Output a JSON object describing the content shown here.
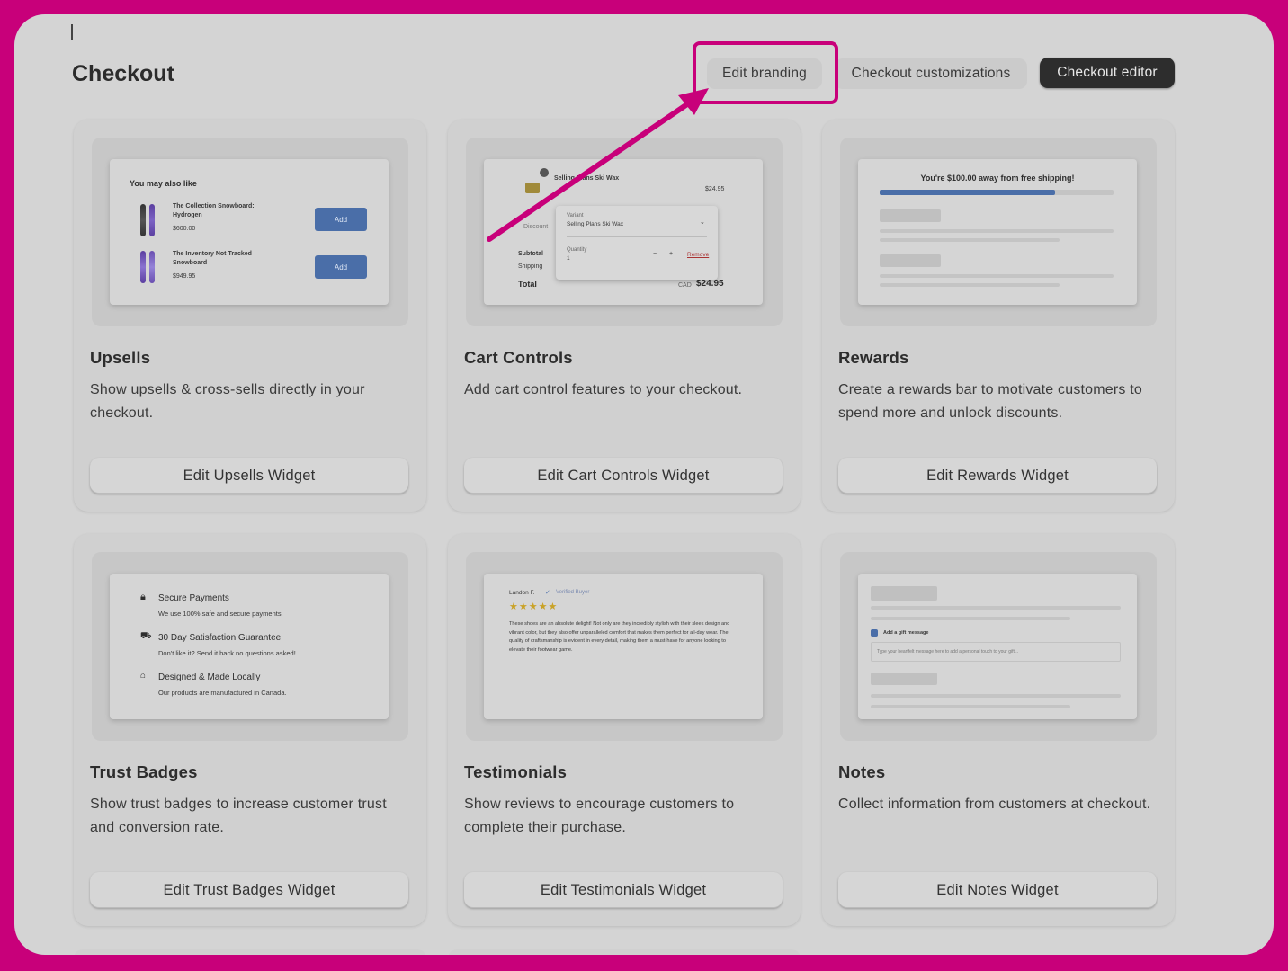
{
  "header": {
    "title": "Checkout",
    "buttons": {
      "branding": "Edit branding",
      "customizations": "Checkout customizations",
      "editor": "Checkout editor"
    }
  },
  "colors": {
    "annotation": "#c8007a",
    "primary_button": "#2d2d2d",
    "add_button": "#4a6ea8"
  },
  "cards": [
    {
      "title": "Upsells",
      "desc": "Show upsells & cross-sells directly in your checkout.",
      "button": "Edit Upsells Widget",
      "preview": {
        "heading": "You may also like",
        "items": [
          {
            "name": "The Collection Snowboard: Hydrogen",
            "price": "$600.00",
            "button": "Add"
          },
          {
            "name": "The Inventory Not Tracked Snowboard",
            "price": "$949.95",
            "button": "Add"
          }
        ]
      }
    },
    {
      "title": "Cart Controls",
      "desc": "Add cart control features to your checkout.",
      "button": "Edit Cart Controls Widget",
      "preview": {
        "product": "Selling Plans Ski Wax",
        "price": "$24.95",
        "variant_label": "Variant",
        "variant_value": "Selling Plans Ski Wax",
        "quantity_label": "Quantity",
        "quantity_value": "1",
        "remove": "Remove",
        "discount": "Discount",
        "subtotal": "Subtotal",
        "shipping": "Shipping",
        "total": "Total",
        "currency": "CAD",
        "total_value": "$24.95"
      }
    },
    {
      "title": "Rewards",
      "desc": "Create a rewards bar to motivate customers to spend more and unlock discounts.",
      "button": "Edit Rewards Widget",
      "preview": {
        "message": "You're $100.00 away from free shipping!",
        "progress": 0.75
      }
    },
    {
      "title": "Trust Badges",
      "desc": "Show trust badges to increase customer trust and conversion rate.",
      "button": "Edit Trust Badges Widget",
      "preview": {
        "badges": [
          {
            "icon": "lock-icon",
            "title": "Secure Payments",
            "text": "We use 100% safe and secure payments."
          },
          {
            "icon": "cart-icon",
            "title": "30 Day Satisfaction Guarantee",
            "text": "Don't like it? Send it back no questions asked!"
          },
          {
            "icon": "store-icon",
            "title": "Designed & Made Locally",
            "text": "Our products are manufactured in Canada."
          }
        ]
      }
    },
    {
      "title": "Testimonials",
      "desc": "Show reviews to encourage customers to complete their purchase.",
      "button": "Edit Testimonials Widget",
      "preview": {
        "author": "Landon F.",
        "badge": "Verified Buyer",
        "stars": "★★★★★",
        "review": "These shoes are an absolute delight! Not only are they incredibly stylish with their sleek design and vibrant color, but they also offer unparalleled comfort that makes them perfect for all-day wear. The quality of craftsmanship is evident in every detail, making them a must-have for anyone looking to elevate their footwear game."
      }
    },
    {
      "title": "Notes",
      "desc": "Collect information from customers at checkout.",
      "button": "Edit Notes Widget",
      "preview": {
        "checkbox_label": "Add a gift message",
        "placeholder": "Type your heartfelt message here to add a personal touch to your gift..."
      }
    }
  ]
}
